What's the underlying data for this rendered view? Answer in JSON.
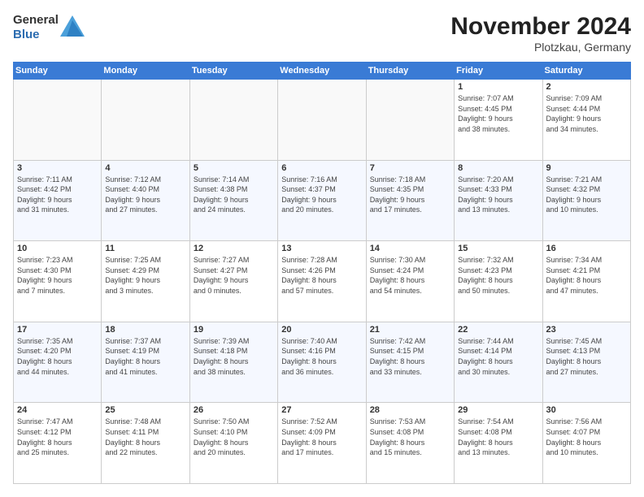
{
  "logo": {
    "general": "General",
    "blue": "Blue"
  },
  "header": {
    "month_year": "November 2024",
    "location": "Plotzkau, Germany"
  },
  "weekdays": [
    "Sunday",
    "Monday",
    "Tuesday",
    "Wednesday",
    "Thursday",
    "Friday",
    "Saturday"
  ],
  "weeks": [
    [
      {
        "day": "",
        "info": ""
      },
      {
        "day": "",
        "info": ""
      },
      {
        "day": "",
        "info": ""
      },
      {
        "day": "",
        "info": ""
      },
      {
        "day": "",
        "info": ""
      },
      {
        "day": "1",
        "info": "Sunrise: 7:07 AM\nSunset: 4:45 PM\nDaylight: 9 hours\nand 38 minutes."
      },
      {
        "day": "2",
        "info": "Sunrise: 7:09 AM\nSunset: 4:44 PM\nDaylight: 9 hours\nand 34 minutes."
      }
    ],
    [
      {
        "day": "3",
        "info": "Sunrise: 7:11 AM\nSunset: 4:42 PM\nDaylight: 9 hours\nand 31 minutes."
      },
      {
        "day": "4",
        "info": "Sunrise: 7:12 AM\nSunset: 4:40 PM\nDaylight: 9 hours\nand 27 minutes."
      },
      {
        "day": "5",
        "info": "Sunrise: 7:14 AM\nSunset: 4:38 PM\nDaylight: 9 hours\nand 24 minutes."
      },
      {
        "day": "6",
        "info": "Sunrise: 7:16 AM\nSunset: 4:37 PM\nDaylight: 9 hours\nand 20 minutes."
      },
      {
        "day": "7",
        "info": "Sunrise: 7:18 AM\nSunset: 4:35 PM\nDaylight: 9 hours\nand 17 minutes."
      },
      {
        "day": "8",
        "info": "Sunrise: 7:20 AM\nSunset: 4:33 PM\nDaylight: 9 hours\nand 13 minutes."
      },
      {
        "day": "9",
        "info": "Sunrise: 7:21 AM\nSunset: 4:32 PM\nDaylight: 9 hours\nand 10 minutes."
      }
    ],
    [
      {
        "day": "10",
        "info": "Sunrise: 7:23 AM\nSunset: 4:30 PM\nDaylight: 9 hours\nand 7 minutes."
      },
      {
        "day": "11",
        "info": "Sunrise: 7:25 AM\nSunset: 4:29 PM\nDaylight: 9 hours\nand 3 minutes."
      },
      {
        "day": "12",
        "info": "Sunrise: 7:27 AM\nSunset: 4:27 PM\nDaylight: 9 hours\nand 0 minutes."
      },
      {
        "day": "13",
        "info": "Sunrise: 7:28 AM\nSunset: 4:26 PM\nDaylight: 8 hours\nand 57 minutes."
      },
      {
        "day": "14",
        "info": "Sunrise: 7:30 AM\nSunset: 4:24 PM\nDaylight: 8 hours\nand 54 minutes."
      },
      {
        "day": "15",
        "info": "Sunrise: 7:32 AM\nSunset: 4:23 PM\nDaylight: 8 hours\nand 50 minutes."
      },
      {
        "day": "16",
        "info": "Sunrise: 7:34 AM\nSunset: 4:21 PM\nDaylight: 8 hours\nand 47 minutes."
      }
    ],
    [
      {
        "day": "17",
        "info": "Sunrise: 7:35 AM\nSunset: 4:20 PM\nDaylight: 8 hours\nand 44 minutes."
      },
      {
        "day": "18",
        "info": "Sunrise: 7:37 AM\nSunset: 4:19 PM\nDaylight: 8 hours\nand 41 minutes."
      },
      {
        "day": "19",
        "info": "Sunrise: 7:39 AM\nSunset: 4:18 PM\nDaylight: 8 hours\nand 38 minutes."
      },
      {
        "day": "20",
        "info": "Sunrise: 7:40 AM\nSunset: 4:16 PM\nDaylight: 8 hours\nand 36 minutes."
      },
      {
        "day": "21",
        "info": "Sunrise: 7:42 AM\nSunset: 4:15 PM\nDaylight: 8 hours\nand 33 minutes."
      },
      {
        "day": "22",
        "info": "Sunrise: 7:44 AM\nSunset: 4:14 PM\nDaylight: 8 hours\nand 30 minutes."
      },
      {
        "day": "23",
        "info": "Sunrise: 7:45 AM\nSunset: 4:13 PM\nDaylight: 8 hours\nand 27 minutes."
      }
    ],
    [
      {
        "day": "24",
        "info": "Sunrise: 7:47 AM\nSunset: 4:12 PM\nDaylight: 8 hours\nand 25 minutes."
      },
      {
        "day": "25",
        "info": "Sunrise: 7:48 AM\nSunset: 4:11 PM\nDaylight: 8 hours\nand 22 minutes."
      },
      {
        "day": "26",
        "info": "Sunrise: 7:50 AM\nSunset: 4:10 PM\nDaylight: 8 hours\nand 20 minutes."
      },
      {
        "day": "27",
        "info": "Sunrise: 7:52 AM\nSunset: 4:09 PM\nDaylight: 8 hours\nand 17 minutes."
      },
      {
        "day": "28",
        "info": "Sunrise: 7:53 AM\nSunset: 4:08 PM\nDaylight: 8 hours\nand 15 minutes."
      },
      {
        "day": "29",
        "info": "Sunrise: 7:54 AM\nSunset: 4:08 PM\nDaylight: 8 hours\nand 13 minutes."
      },
      {
        "day": "30",
        "info": "Sunrise: 7:56 AM\nSunset: 4:07 PM\nDaylight: 8 hours\nand 10 minutes."
      }
    ]
  ]
}
